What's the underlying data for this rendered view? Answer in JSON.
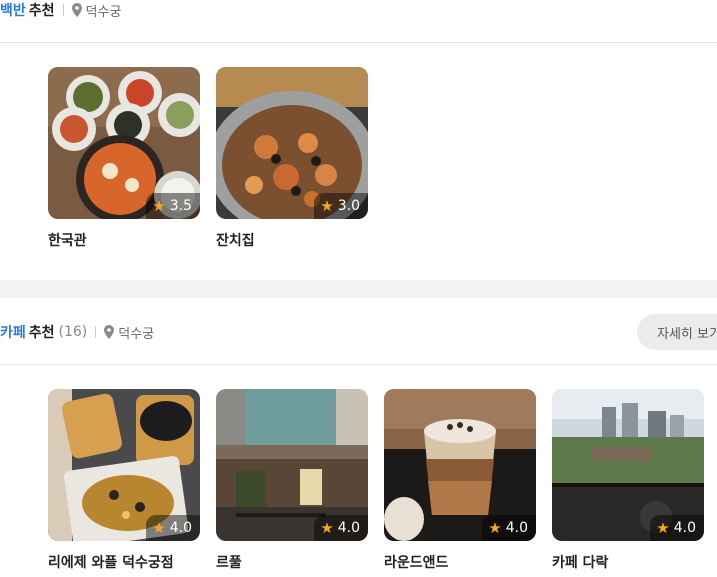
{
  "section1": {
    "category": "백반",
    "suffix": "추천",
    "location": "덕수궁",
    "places": [
      {
        "name": "한국관",
        "rating": "3.5"
      },
      {
        "name": "잔치집",
        "rating": "3.0"
      }
    ]
  },
  "section2": {
    "category": "카페",
    "suffix": "추천",
    "count": "(16)",
    "location": "덕수궁",
    "more_label": "자세히 보기",
    "places": [
      {
        "name": "리에제 와플 덕수궁점",
        "rating": "4.0"
      },
      {
        "name": "르풀",
        "rating": "4.0"
      },
      {
        "name": "라운드앤드",
        "rating": "4.0"
      },
      {
        "name": "카페 다락",
        "rating": "4.0"
      }
    ]
  },
  "colors": {
    "accent": "#2a7ae2",
    "star": "#f5a623"
  },
  "icons": {
    "location": "location-pin-icon",
    "rating": "star-icon"
  }
}
